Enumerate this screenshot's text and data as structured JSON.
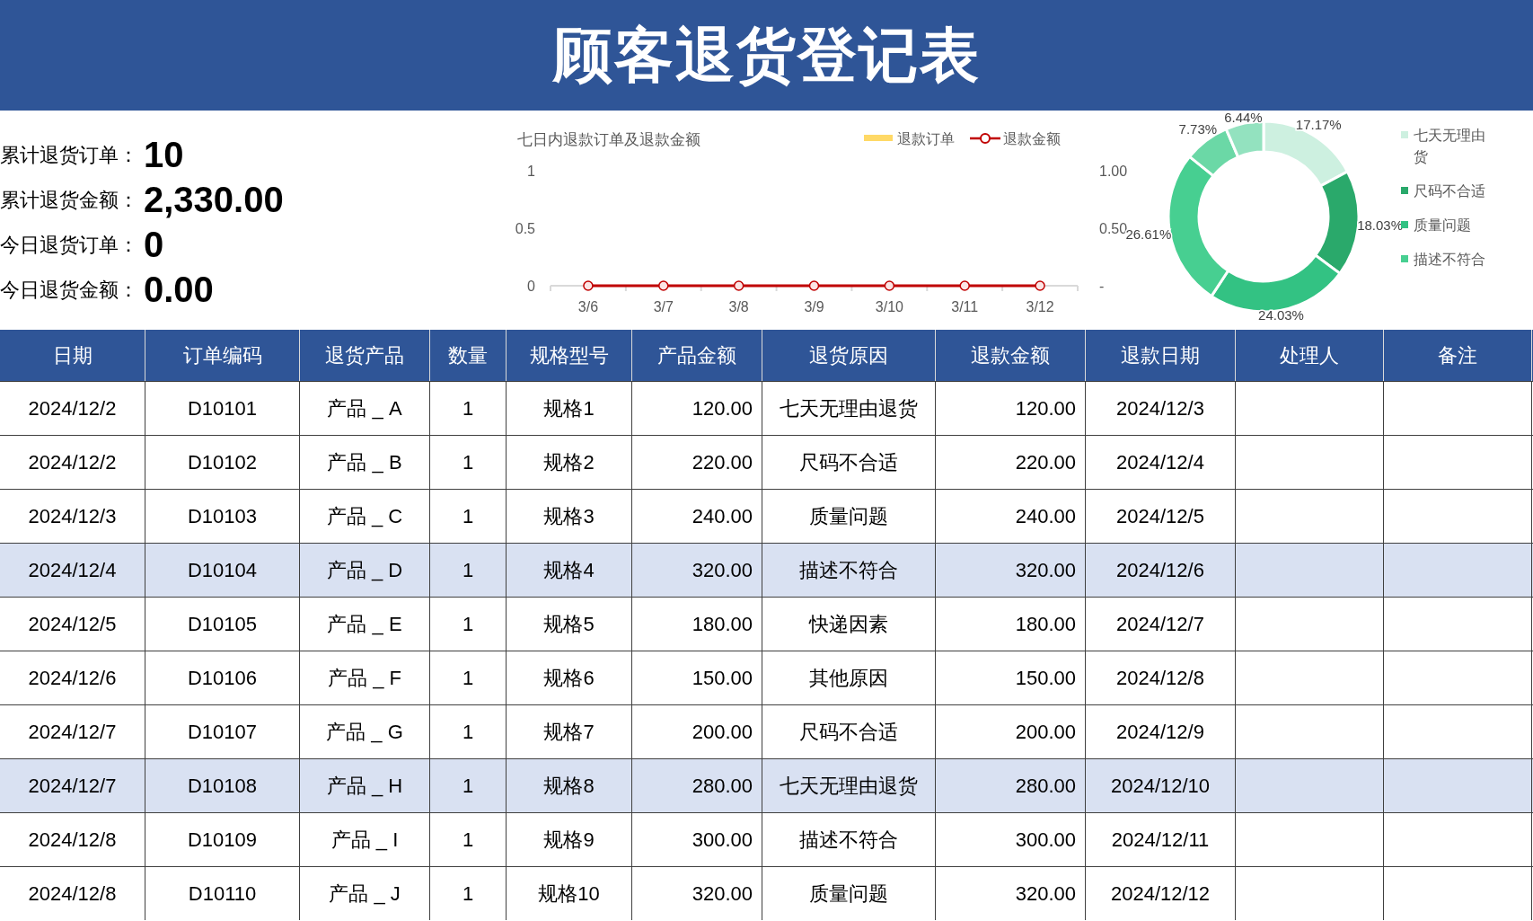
{
  "title": "顾客退货登记表",
  "summary": [
    {
      "label": "累计退货订单：",
      "value": "10"
    },
    {
      "label": "累计退货金额：",
      "value": "2,330.00"
    },
    {
      "label": "今日退货订单：",
      "value": "0"
    },
    {
      "label": "今日退货金额：",
      "value": "0.00"
    }
  ],
  "trend_chart": {
    "chart_data": {
      "type": "line",
      "title": "七日内退款订单及退款金额",
      "categories": [
        "3/6",
        "3/7",
        "3/8",
        "3/9",
        "3/10",
        "3/11",
        "3/12"
      ],
      "series": [
        {
          "name": "退款金额",
          "color": "#c00000",
          "marker": "circle",
          "values": [
            0,
            0,
            0,
            0,
            0,
            0,
            0
          ]
        }
      ],
      "ylim": [
        0,
        1
      ],
      "yticks": [
        0,
        {
          "value": 0.5,
          "label": "0.5"
        },
        1
      ],
      "y2lim": [
        0,
        1
      ],
      "y2ticks": [
        {
          "value": 0,
          "label": "-"
        },
        {
          "value": 0.5,
          "label": "0.50"
        },
        {
          "value": 1,
          "label": "1.00"
        }
      ]
    },
    "legend": [
      {
        "label": "退款订单",
        "color": "#ffd966",
        "kind": "bar"
      }
    ]
  },
  "reason_chart": {
    "chart_data": {
      "type": "donut",
      "data_labels": true,
      "values": [
        17.17,
        18.03,
        24.03,
        26.61,
        7.73,
        6.44
      ],
      "value_labels": [
        "17.17%",
        "18.03%",
        "24.03%",
        "26.61%",
        "7.73%",
        "6.44%"
      ],
      "colors": [
        "#cdf0e0",
        "#2aa96b",
        "#33c283",
        "#47cf91",
        "#6bd8a6",
        "#93e2bf"
      ]
    },
    "legend": [
      {
        "lines": [
          "七天无理由",
          "货"
        ],
        "color": "#cdf0e0"
      },
      {
        "lines": [
          "尺码不合适"
        ],
        "color": "#2aa96b"
      },
      {
        "lines": [
          "质量问题"
        ],
        "color": "#33c283"
      },
      {
        "lines": [
          "描述不符合"
        ],
        "color": "#47cf91"
      }
    ]
  },
  "table": {
    "columns": [
      "日期",
      "订单编码",
      "退货产品",
      "数量",
      "规格型号",
      "产品金额",
      "退货原因",
      "退款金额",
      "退款日期",
      "处理人",
      "备注"
    ],
    "rows": [
      {
        "selected": false,
        "cells": [
          "2024/12/2",
          "D10101",
          "产品 _ A",
          "1",
          "规格1",
          "120.00",
          "七天无理由退货",
          "120.00",
          "2024/12/3"
        ]
      },
      {
        "selected": false,
        "cells": [
          "2024/12/2",
          "D10102",
          "产品 _ B",
          "1",
          "规格2",
          "220.00",
          "尺码不合适",
          "220.00",
          "2024/12/4"
        ]
      },
      {
        "selected": false,
        "cells": [
          "2024/12/3",
          "D10103",
          "产品 _ C",
          "1",
          "规格3",
          "240.00",
          "质量问题",
          "240.00",
          "2024/12/5"
        ]
      },
      {
        "selected": true,
        "cells": [
          "2024/12/4",
          "D10104",
          "产品 _ D",
          "1",
          "规格4",
          "320.00",
          "描述不符合",
          "320.00",
          "2024/12/6"
        ]
      },
      {
        "selected": false,
        "cells": [
          "2024/12/5",
          "D10105",
          "产品 _ E",
          "1",
          "规格5",
          "180.00",
          "快递因素",
          "180.00",
          "2024/12/7"
        ]
      },
      {
        "selected": false,
        "cells": [
          "2024/12/6",
          "D10106",
          "产品 _ F",
          "1",
          "规格6",
          "150.00",
          "其他原因",
          "150.00",
          "2024/12/8"
        ]
      },
      {
        "selected": false,
        "cells": [
          "2024/12/7",
          "D10107",
          "产品 _ G",
          "1",
          "规格7",
          "200.00",
          "尺码不合适",
          "200.00",
          "2024/12/9"
        ]
      },
      {
        "selected": true,
        "cells": [
          "2024/12/7",
          "D10108",
          "产品 _ H",
          "1",
          "规格8",
          "280.00",
          "七天无理由退货",
          "280.00",
          "2024/12/10"
        ]
      },
      {
        "selected": false,
        "cells": [
          "2024/12/8",
          "D10109",
          "产品 _ I",
          "1",
          "规格9",
          "300.00",
          "描述不符合",
          "300.00",
          "2024/12/11"
        ]
      },
      {
        "selected": false,
        "cells": [
          "2024/12/8",
          "D10110",
          "产品 _ J",
          "1",
          "规格10",
          "320.00",
          "质量问题",
          "320.00",
          "2024/12/12"
        ]
      }
    ]
  }
}
